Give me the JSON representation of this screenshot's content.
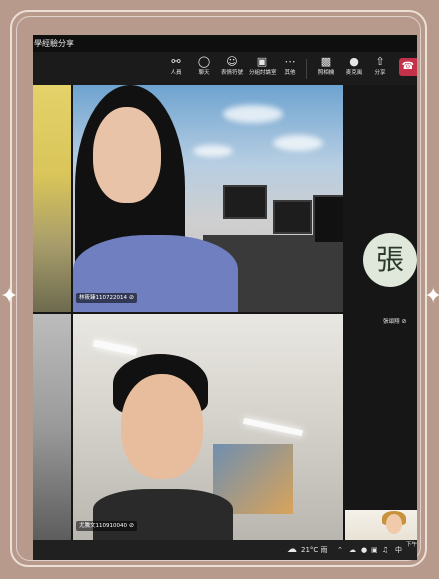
{
  "window": {
    "title": "學經驗分享"
  },
  "toolbar": {
    "items": [
      {
        "id": "people",
        "label": "人員",
        "icon": "people-icon"
      },
      {
        "id": "chat",
        "label": "聊天",
        "icon": "chat-icon"
      },
      {
        "id": "react",
        "label": "表情符號",
        "icon": "emoji-icon"
      },
      {
        "id": "rooms",
        "label": "分組討論室",
        "icon": "breakout-rooms-icon"
      },
      {
        "id": "more",
        "label": "其他",
        "icon": "more-icon"
      },
      {
        "id": "camera",
        "label": "照相機",
        "icon": "camera-icon"
      },
      {
        "id": "mic",
        "label": "麥克風",
        "icon": "mic-icon"
      },
      {
        "id": "share",
        "label": "分享",
        "icon": "share-icon"
      }
    ],
    "leave_icon": "phone-hangup-icon"
  },
  "participants": {
    "top_center": "林筱臻110722014",
    "bottom_center": "尤騰文110910040",
    "avatar_initial": "張",
    "avatar_name": "張頌翔"
  },
  "taskbar": {
    "weather": "21°C 雨",
    "clock": "下午"
  },
  "colors": {
    "leave": "#c4314b",
    "background": "#b89a8c"
  }
}
